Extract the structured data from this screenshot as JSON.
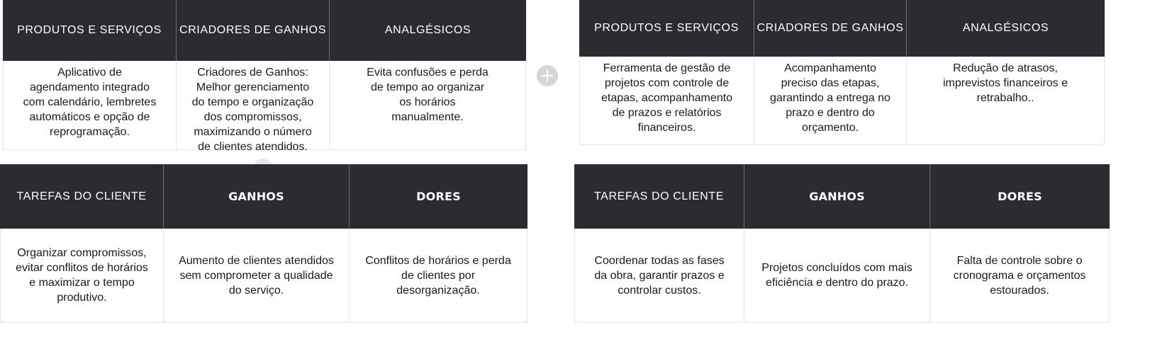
{
  "add_button_icon": "plus-icon",
  "tables": {
    "t1": {
      "headers": [
        "PRODUTOS E SERVIÇOS",
        "CRIADORES DE GANHOS",
        "ANALGÉSICOS"
      ],
      "cells": [
        "Aplicativo de\nagendamento integrado\ncom calendário, lembretes\nautomáticos e opção de\nreprogramação.",
        "Criadores de Ganhos:\nMelhor gerenciamento\ndo tempo e organização\ndos compromissos,\nmaximizando o número\nde clientes atendidos.",
        "Evita confusões e perda\nde tempo ao organizar\nos horários\nmanualmente."
      ]
    },
    "t2": {
      "headers": [
        "PRODUTOS E SERVIÇOS",
        "CRIADORES DE GANHOS",
        "ANALGÉSICOS"
      ],
      "cells": [
        "Ferramenta de gestão de\nprojetos com controle de\netapas, acompanhamento\nde prazos e relatórios\nfinanceiros.",
        "Acompanhamento\npreciso das etapas,\ngarantindo a entrega no\nprazo e dentro do\norçamento.",
        "Redução de atrasos,\nimprevistos financeiros e\nretrabalho.."
      ]
    },
    "t3": {
      "headers": [
        "TAREFAS DO CLIENTE",
        "GANHOS",
        "DORES"
      ],
      "cells": [
        "Organizar compromissos,\nevitar conflitos de horários\ne maximizar o tempo\nprodutivo.",
        "Aumento de clientes atendidos\nsem comprometer a qualidade\ndo serviço.",
        "Conflitos de horários e perda\nde clientes por\ndesorganização."
      ]
    },
    "t4": {
      "headers": [
        "TAREFAS DO CLIENTE",
        "GANHOS",
        "DORES"
      ],
      "cells": [
        "Coordenar todas as fases\nda obra, garantir prazos e\ncontrolar custos.",
        "Projetos concluídos com mais\neficiência e dentro do prazo.",
        "Falta de controle sobre o\ncronograma e orçamentos\nestourados."
      ]
    }
  }
}
